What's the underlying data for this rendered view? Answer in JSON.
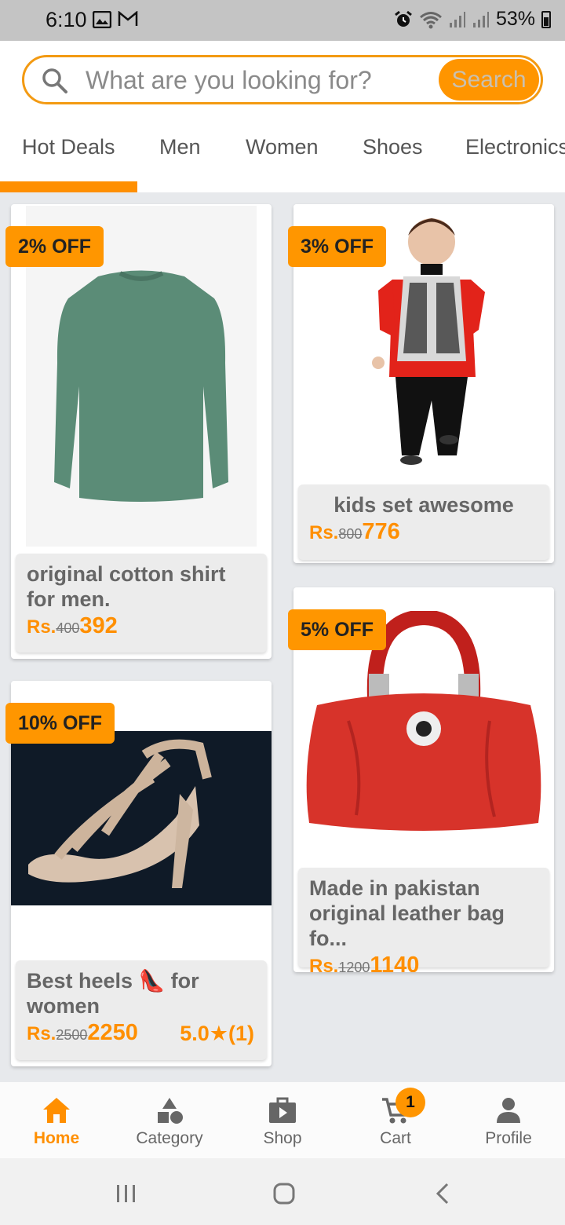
{
  "status_bar": {
    "time": "6:10",
    "battery": "53%"
  },
  "search": {
    "placeholder": "What are you looking for?",
    "button_label": "Search"
  },
  "tabs": [
    {
      "label": "Hot Deals",
      "active": true
    },
    {
      "label": "Men"
    },
    {
      "label": "Women"
    },
    {
      "label": "Shoes"
    },
    {
      "label": "Electronics"
    }
  ],
  "colors": {
    "accent": "#ff9500",
    "background": "#e7e9ec"
  },
  "products": [
    {
      "discount": "2% OFF",
      "title": "original cotton shirt for men.",
      "currency": "Rs.",
      "old_price": "400",
      "price": "392"
    },
    {
      "discount": "3% OFF",
      "title": "kids set awesome",
      "currency": "Rs.",
      "old_price": "800",
      "price": "776"
    },
    {
      "discount": "10% OFF",
      "title": "Best heels 👠 for women",
      "currency": "Rs.",
      "old_price": "2500",
      "price": "2250",
      "rating": "5.0★(1)"
    },
    {
      "discount": "5% OFF",
      "title": "Made in pakistan original leather bag fo...",
      "currency": "Rs.",
      "old_price": "1200",
      "price": "1140"
    }
  ],
  "bottom_nav": [
    {
      "label": "Home",
      "icon": "home-icon",
      "active": true
    },
    {
      "label": "Category",
      "icon": "category-icon"
    },
    {
      "label": "Shop",
      "icon": "shop-icon"
    },
    {
      "label": "Cart",
      "icon": "cart-icon",
      "badge": "1"
    },
    {
      "label": "Profile",
      "icon": "profile-icon"
    }
  ]
}
